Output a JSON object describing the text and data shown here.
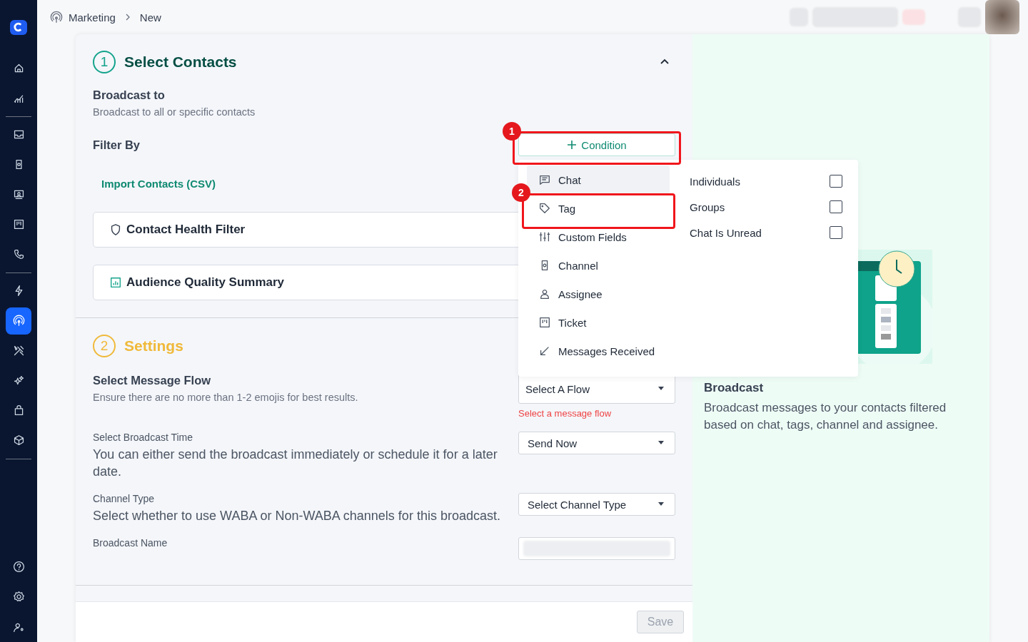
{
  "breadcrumb": {
    "items": [
      "Marketing",
      "New"
    ]
  },
  "sidebar": {
    "groups": [
      [
        {
          "kind": "home",
          "selected": false
        },
        {
          "kind": "analytics",
          "selected": false
        }
      ],
      [
        {
          "kind": "inbox",
          "selected": false
        },
        {
          "kind": "device",
          "selected": false
        },
        {
          "kind": "contacts",
          "selected": false
        },
        {
          "kind": "board",
          "selected": false
        },
        {
          "kind": "phone",
          "selected": false
        }
      ],
      [
        {
          "kind": "bolt",
          "selected": false
        },
        {
          "kind": "broadcast",
          "selected": true
        },
        {
          "kind": "tools",
          "selected": false
        },
        {
          "kind": "sparkles",
          "selected": false
        },
        {
          "kind": "bag",
          "selected": false
        },
        {
          "kind": "cube",
          "selected": false
        }
      ],
      [
        {
          "kind": "help",
          "selected": false
        },
        {
          "kind": "settings",
          "selected": false
        },
        {
          "kind": "user-settings",
          "selected": false
        }
      ]
    ]
  },
  "select_contacts": {
    "number": "1",
    "title": "Select Contacts",
    "expanded": true,
    "broadcast_to": {
      "label": "Broadcast to",
      "hint": "Broadcast to all or specific contacts"
    },
    "filter_by": {
      "label": "Filter By",
      "button": "Condition"
    },
    "import_link": "Import Contacts (CSV)",
    "panels": [
      {
        "kind": "shield",
        "title": "Contact Health Filter"
      },
      {
        "kind": "chart",
        "title": "Audience Quality Summary"
      }
    ]
  },
  "settings": {
    "number": "2",
    "title": "Settings",
    "fields": [
      {
        "label": "Select Message Flow",
        "hint": "Ensure there are no more than 1-2 emojis for best results.",
        "strong": true,
        "value": "Select A Flow",
        "error": "Select a message flow"
      },
      {
        "label": "Select Broadcast Time",
        "hint": "You can either send the broadcast immediately or schedule it for a later date.",
        "strong": false,
        "value": "Send Now"
      },
      {
        "label": "Channel Type",
        "hint": "Select whether to use WABA or Non-WABA channels for this broadcast.",
        "strong": false,
        "value": "Select Channel Type"
      },
      {
        "label": "Broadcast Name",
        "strong": false,
        "kind": "text"
      }
    ]
  },
  "save_button": {
    "label": "Save",
    "disabled": true
  },
  "info_panel": {
    "title": "Broadcast",
    "text": "Broadcast messages to your contacts filtered based on chat, tags, channel and assignee."
  },
  "condition_menu": {
    "categories": [
      {
        "kind": "chat",
        "label": "Chat",
        "selected": true
      },
      {
        "kind": "tag",
        "label": "Tag",
        "selected": false
      },
      {
        "kind": "sliders",
        "label": "Custom Fields",
        "selected": false
      },
      {
        "kind": "device",
        "label": "Channel",
        "selected": false
      },
      {
        "kind": "person",
        "label": "Assignee",
        "selected": false
      },
      {
        "kind": "board",
        "label": "Ticket",
        "selected": false
      },
      {
        "kind": "arrow",
        "label": "Messages Received",
        "selected": false
      }
    ],
    "options": [
      {
        "label": "Individuals",
        "checked": false
      },
      {
        "label": "Groups",
        "checked": false
      },
      {
        "label": "Chat Is Unread",
        "checked": false
      }
    ]
  },
  "annotations": [
    "1",
    "2"
  ]
}
